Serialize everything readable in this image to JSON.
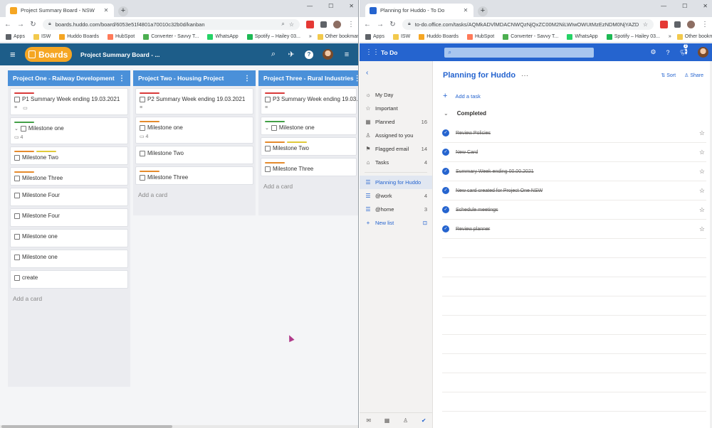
{
  "left_browser": {
    "tab_title": "Project Summary Board - NSW",
    "url": "boards.huddo.com/board/6053e51f4801a70010c32b0d/kanban",
    "bookmarks": [
      "Apps",
      "ISW",
      "Huddo Boards",
      "HubSpot",
      "Converter - Savvy T...",
      "WhatsApp",
      "Spotify – Hailey 03..."
    ],
    "other_bookmarks": "Other bookmarks",
    "more": "»"
  },
  "huddo": {
    "logo_text": "Boards",
    "board_title": "Project Summary Board - ...",
    "columns": [
      {
        "title": "Project One - Railway Development",
        "cards": [
          {
            "title": "P1 Summary Week ending 19.03.2021",
            "labels": [
              "#d93a3a"
            ],
            "meta": [
              "≡",
              "▭"
            ],
            "expand": false
          },
          {
            "title": "Milestone one",
            "labels": [
              "#43a047"
            ],
            "meta": [
              "▭ 4"
            ],
            "expand": true
          },
          {
            "title": "Milestone Two",
            "labels": [
              "#e58a2c",
              "#e0c93a"
            ],
            "meta": [],
            "expand": false
          },
          {
            "title": "Milestone Three",
            "labels": [
              "#e58a2c"
            ],
            "meta": [],
            "expand": false
          },
          {
            "title": "Milestone Four",
            "labels": [],
            "meta": [],
            "expand": false
          },
          {
            "title": "Milestone Four",
            "labels": [],
            "meta": [],
            "expand": false
          },
          {
            "title": "Milestone one",
            "labels": [],
            "meta": [],
            "expand": false
          },
          {
            "title": "Milestone one",
            "labels": [],
            "meta": [],
            "expand": false
          },
          {
            "title": "create",
            "labels": [],
            "meta": [],
            "expand": false
          }
        ],
        "add_card": "Add a card"
      },
      {
        "title": "Project Two - Housing Project",
        "cards": [
          {
            "title": "P2 Summary Week ending 19.03.2021",
            "labels": [
              "#d93a3a"
            ],
            "meta": [
              "≡"
            ],
            "expand": false
          },
          {
            "title": "Milestone one",
            "labels": [
              "#e58a2c"
            ],
            "meta": [
              "▭ 4"
            ],
            "expand": false
          },
          {
            "title": "Milestone Two",
            "labels": [],
            "meta": [],
            "expand": false
          },
          {
            "title": "Milestone Three",
            "labels": [
              "#e58a2c"
            ],
            "meta": [],
            "expand": false
          }
        ],
        "add_card": "Add a card"
      },
      {
        "title": "Project Three - Rural Industries",
        "cards": [
          {
            "title": "P3 Summary Week ending 19.03.2021",
            "labels": [
              "#d93a3a"
            ],
            "meta": [
              "≡"
            ],
            "expand": false
          },
          {
            "title": "Milestone one",
            "labels": [
              "#43a047"
            ],
            "meta": [],
            "expand": true
          },
          {
            "title": "Milestone Two",
            "labels": [
              "#e58a2c",
              "#e0c93a"
            ],
            "meta": [],
            "expand": false
          },
          {
            "title": "Milestone Three",
            "labels": [
              "#e58a2c"
            ],
            "meta": [],
            "expand": false
          }
        ],
        "add_card": "Add a card"
      }
    ]
  },
  "right_browser": {
    "tab_title": "Planning for Huddo - To Do",
    "url": "to-do.office.com/tasks/AQMkADVlMDACNWQzNjQxZC00M2NiLWIwOWUtMzEzNDM0NjYAZDFjMA...",
    "bookmarks": [
      "Apps",
      "ISW",
      "Huddo Boards",
      "HubSpot",
      "Converter - Savvy T...",
      "WhatsApp",
      "Spotify – Hailey 03..."
    ],
    "other_bookmarks": "Other bookmarks",
    "more": "»"
  },
  "todo": {
    "brand": "To Do",
    "notification_count": "2",
    "sidebar": [
      {
        "label": "My Day",
        "icon": "☼",
        "count": ""
      },
      {
        "label": "Important",
        "icon": "☆",
        "count": ""
      },
      {
        "label": "Planned",
        "icon": "▦",
        "count": "16"
      },
      {
        "label": "Assigned to you",
        "icon": "♙",
        "count": ""
      },
      {
        "label": "Flagged email",
        "icon": "⚑",
        "count": "14"
      },
      {
        "label": "Tasks",
        "icon": "⌂",
        "count": "4"
      }
    ],
    "lists": [
      {
        "label": "Planning for Huddo",
        "count": ""
      },
      {
        "label": "@work",
        "count": "4"
      },
      {
        "label": "@home",
        "count": "3"
      }
    ],
    "new_list": "New list",
    "list_title": "Planning for Huddo",
    "sort_label": "Sort",
    "share_label": "Share",
    "add_task": "Add a task",
    "completed_label": "Completed",
    "completed_tasks": [
      "Review Policies",
      "New Card",
      "Summary Week ending 00.00.2021",
      "New card created for Project One NSW",
      "Schedule meetings",
      "Review planner"
    ]
  },
  "colors": {
    "huddo_header": "#1d5d89",
    "column_header": "#4a90d9",
    "todo_blue": "#2564cf",
    "logo_orange": "#f5a623"
  }
}
